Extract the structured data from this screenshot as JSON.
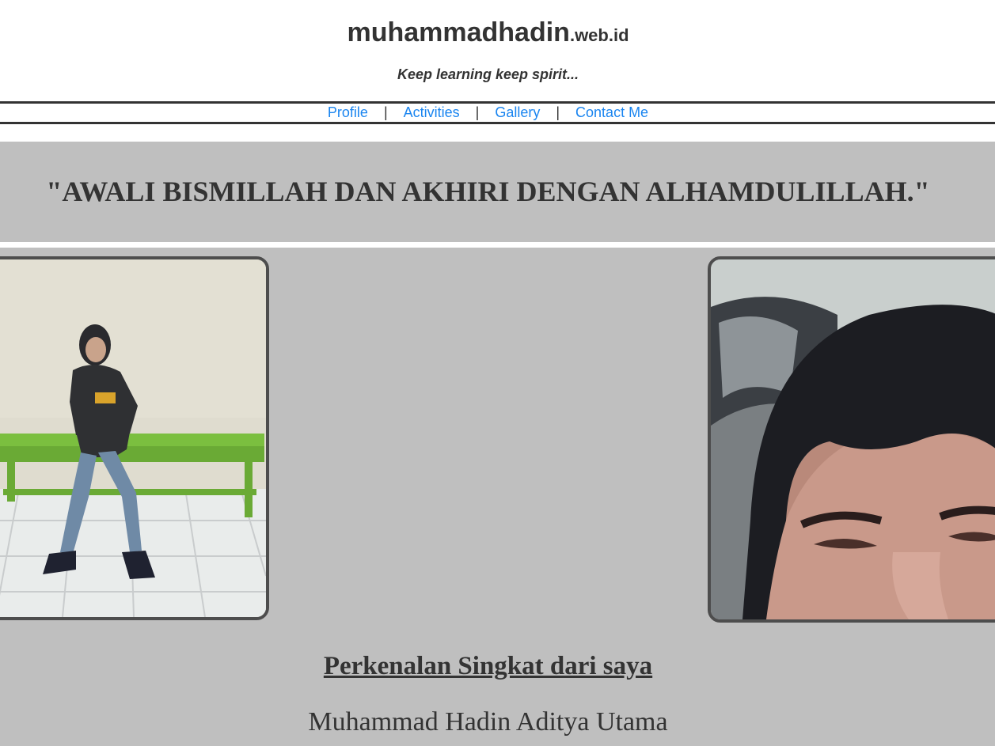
{
  "header": {
    "site_name": "muhammadhadin",
    "site_domain_suffix": ".web.id",
    "tagline": "Keep learning keep spirit..."
  },
  "nav": {
    "items": [
      {
        "label": "Profile"
      },
      {
        "label": "Activities"
      },
      {
        "label": "Gallery"
      },
      {
        "label": "Contact Me"
      }
    ],
    "separator": "|"
  },
  "quote": {
    "text": "\"AWALI BISMILLAH DAN AKHIRI DENGAN ALHAMDULILLAH.\""
  },
  "intro": {
    "heading": "Perkenalan Singkat dari saya",
    "name": "Muhammad Hadin Aditya Utama"
  },
  "colors": {
    "text": "#333333",
    "link": "#1a85f0",
    "band_background": "#bfbfbf",
    "photo_border": "#4d4d4d"
  }
}
